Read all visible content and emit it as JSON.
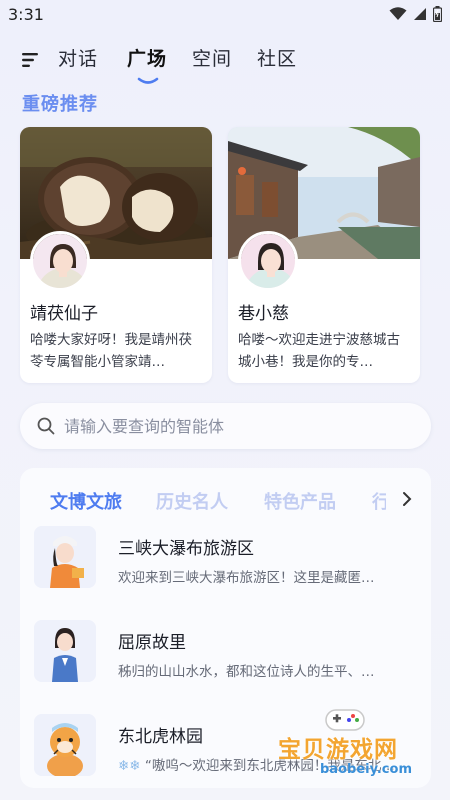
{
  "status": {
    "time": "3:31"
  },
  "tabs": [
    {
      "label": "对话"
    },
    {
      "label": "广场"
    },
    {
      "label": "空间"
    },
    {
      "label": "社区"
    }
  ],
  "active_tab": "广场",
  "section_title": "重磅推荐",
  "featured": [
    {
      "name": "靖茯仙子",
      "desc": "哈喽大家好呀！我是靖州茯苓专属智能小管家靖…"
    },
    {
      "name": "巷小慈",
      "desc": "哈喽～欢迎走进宁波慈城古城小巷！我是你的专…"
    }
  ],
  "search": {
    "placeholder": "请输入要查询的智能体"
  },
  "categories": [
    "文博文旅",
    "历史名人",
    "特色产品",
    "行"
  ],
  "list": [
    {
      "title": "三峡大瀑布旅游区",
      "sub": "欢迎来到三峡大瀑布旅游区！这里是藏匿…"
    },
    {
      "title": "屈原故里",
      "sub": "秭归的山山水水，都和这位诗人的生平、…"
    },
    {
      "title": "东北虎林园",
      "sub": "“嗷呜～欢迎来到东北虎林园！我是东北…"
    }
  ],
  "watermark": {
    "text": "宝贝游戏网",
    "url": "baobeiy.com"
  },
  "colors": {
    "accent": "#4e7cf0",
    "section": "#6b8ef0",
    "inactive_cat": "#c2cdf2",
    "watermark": "#f3a531"
  }
}
